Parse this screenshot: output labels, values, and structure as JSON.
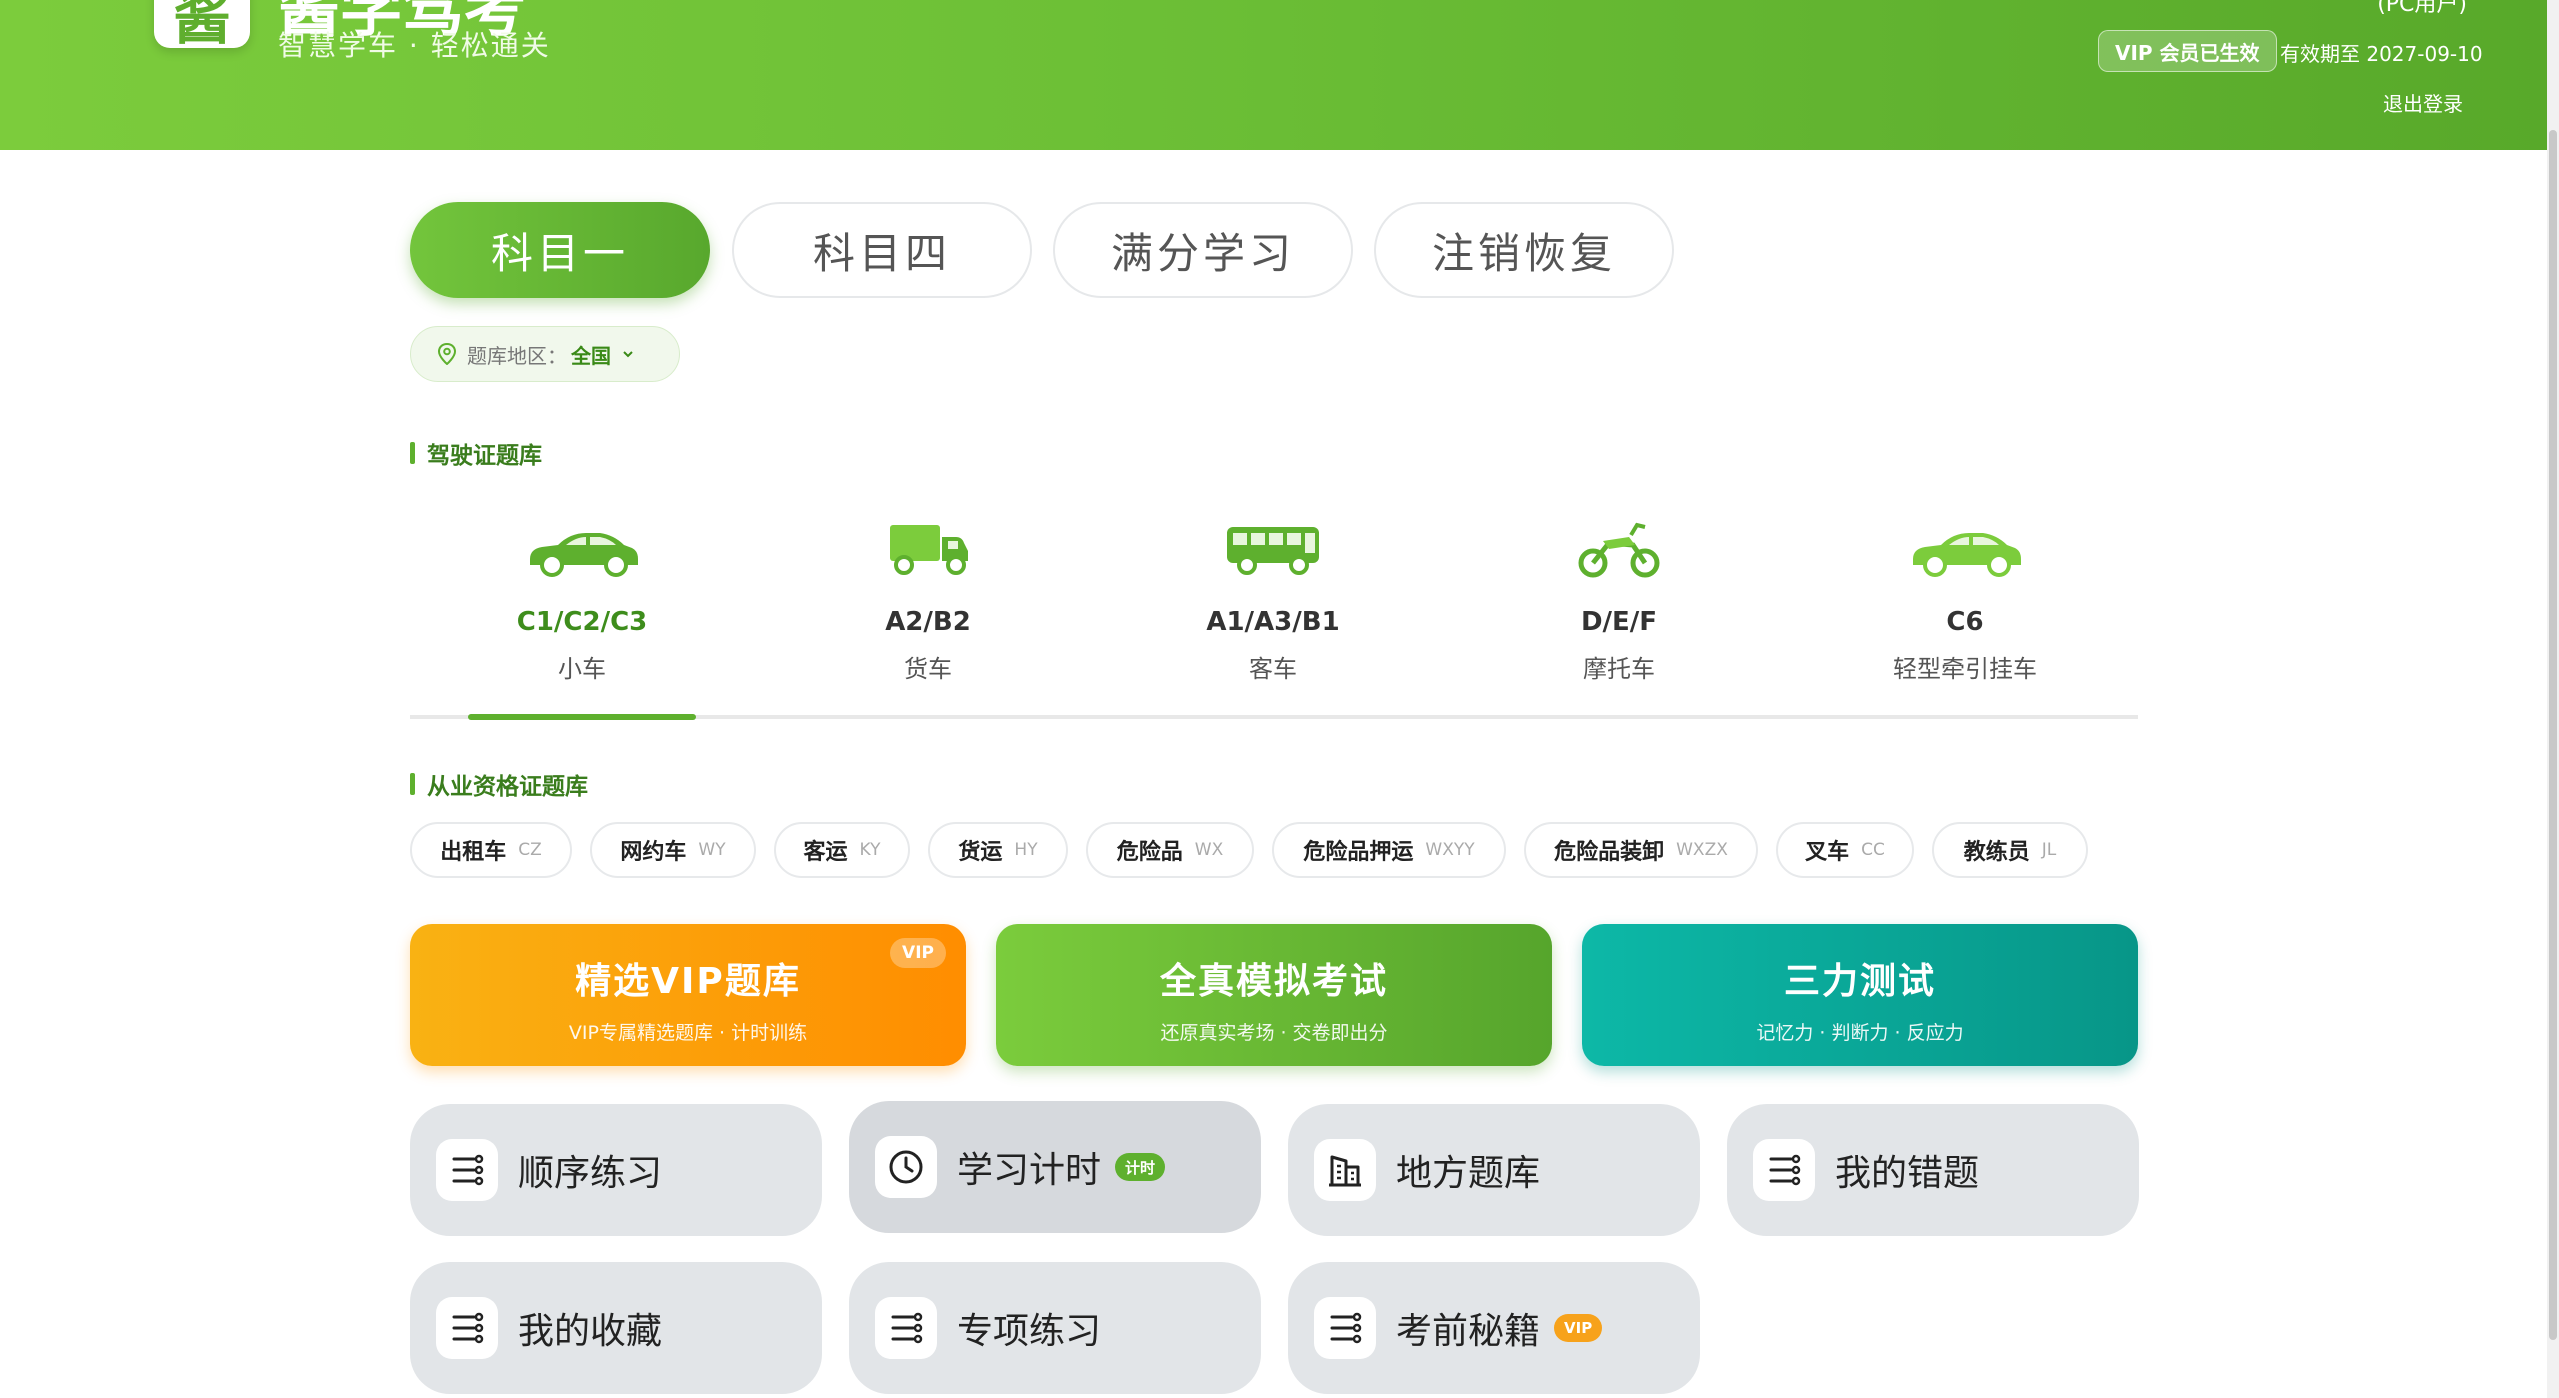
{
  "header": {
    "logo_glyph": "酱",
    "brand_title": "酱学驾考",
    "brand_subtitle": "智慧学车 · 轻松通关",
    "pc_user": "(PC用户)",
    "vip_badge": "VIP 会员已生效",
    "expiry": "有效期至 2027-09-10",
    "logout": "退出登录"
  },
  "tabs": [
    {
      "label": "科目一",
      "active": true
    },
    {
      "label": "科目四",
      "active": false
    },
    {
      "label": "满分学习",
      "active": false
    },
    {
      "label": "注销恢复",
      "active": false
    }
  ],
  "region": {
    "label": "题库地区：",
    "value": "全国"
  },
  "sections": {
    "license": "驾驶证题库",
    "qualification": "从业资格证题库"
  },
  "vehicles": [
    {
      "code": "C1/C2/C3",
      "name": "小车",
      "icon": "car-icon",
      "active": true
    },
    {
      "code": "A2/B2",
      "name": "货车",
      "icon": "truck-icon",
      "active": false
    },
    {
      "code": "A1/A3/B1",
      "name": "客车",
      "icon": "bus-icon",
      "active": false
    },
    {
      "code": "D/E/F",
      "name": "摩托车",
      "icon": "motorcycle-icon",
      "active": false
    },
    {
      "code": "C6",
      "name": "轻型牵引挂车",
      "icon": "car-icon",
      "active": false
    }
  ],
  "qualifications": [
    {
      "name": "出租车",
      "code": "CZ"
    },
    {
      "name": "网约车",
      "code": "WY"
    },
    {
      "name": "客运",
      "code": "KY"
    },
    {
      "name": "货运",
      "code": "HY"
    },
    {
      "name": "危险品",
      "code": "WX"
    },
    {
      "name": "危险品押运",
      "code": "WXYY"
    },
    {
      "name": "危险品装卸",
      "code": "WXZX"
    },
    {
      "name": "叉车",
      "code": "CC"
    },
    {
      "name": "教练员",
      "code": "JL"
    }
  ],
  "features": [
    {
      "title": "精选VIP题库",
      "subtitle": "VIP专属精选题库 · 计时训练",
      "tag": "VIP"
    },
    {
      "title": "全真模拟考试",
      "subtitle": "还原真实考场 · 交卷即出分"
    },
    {
      "title": "三力测试",
      "subtitle": "记忆力 · 判断力 · 反应力"
    }
  ],
  "tiles": [
    {
      "label": "顺序练习",
      "icon": "list-icon"
    },
    {
      "label": "学习计时",
      "icon": "clock-icon",
      "badge": "计时"
    },
    {
      "label": "地方题库",
      "icon": "building-icon"
    },
    {
      "label": "我的错题",
      "icon": "list-icon"
    },
    {
      "label": "我的收藏",
      "icon": "list-icon"
    },
    {
      "label": "专项练习",
      "icon": "list-icon"
    },
    {
      "label": "考前秘籍",
      "icon": "list-icon",
      "badge": "VIP"
    }
  ],
  "colors": {
    "brand_green": "#5eb02e",
    "vip_orange": "#ff8d00",
    "teal": "#079688"
  }
}
